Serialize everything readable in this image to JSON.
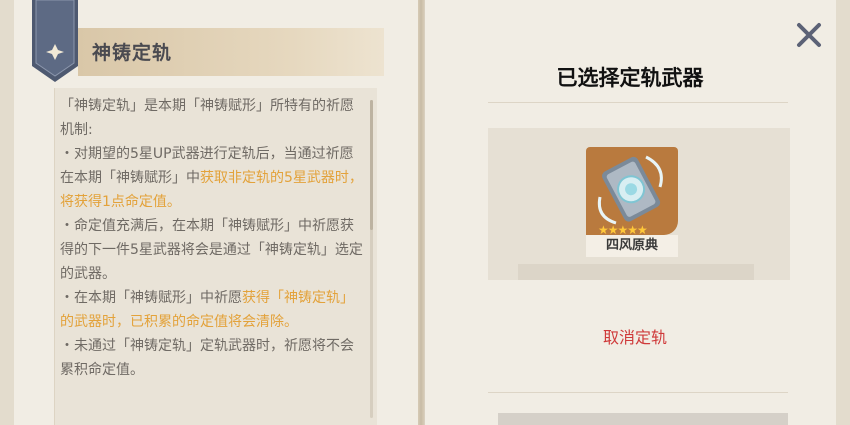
{
  "left_page": {
    "title": "神铸定轨",
    "paragraphs": [
      [
        {
          "text": "「神铸定轨」是本期「神铸赋形」所特有的祈愿机制:",
          "highlight": false
        }
      ],
      [
        {
          "text": "・对期望的5星UP武器进行定轨后，当通过祈愿在本期「神铸赋形」中",
          "highlight": false
        },
        {
          "text": "获取非定轨的5星武器时，将获得1点命定值。",
          "highlight": true
        }
      ],
      [
        {
          "text": "・命定值充满后，在本期「神铸赋形」中祈愿获得的下一件5星武器将会是通过「神铸定轨」选定的武器。",
          "highlight": false
        }
      ],
      [
        {
          "text": "・在本期「神铸赋形」中祈愿",
          "highlight": false
        },
        {
          "text": "获得「神铸定轨」的武器时，已积累的命定值将会清除。",
          "highlight": true
        }
      ],
      [
        {
          "text": "・未通过「神铸定轨」定轨武器时，祈愿将不会累积命定值。",
          "highlight": false
        }
      ]
    ]
  },
  "right_page": {
    "title": "已选择定轨武器",
    "weapon": {
      "name": "四风原典",
      "stars": "★★★★★",
      "rarity": 5
    },
    "cancel_label": "取消定轨"
  },
  "colors": {
    "highlight": "#e3a23a",
    "cancel": "#cf3a3a",
    "card_bg": "#b97a3e"
  }
}
